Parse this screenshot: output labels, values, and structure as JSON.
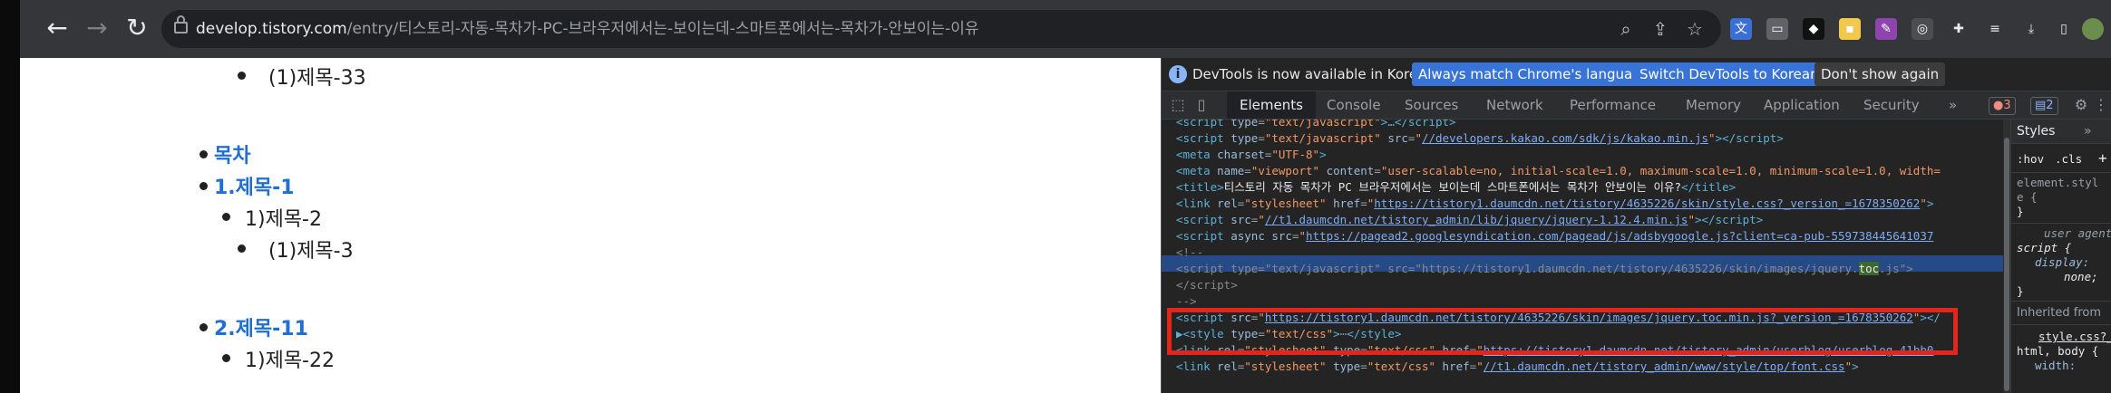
{
  "browser": {
    "url_host": "develop.tistory.com",
    "url_path": "/entry/티스토리-자동-목차가-PC-브라우저에서는-보이는데-스마트폰에서는-목차가-안보이는-이유"
  },
  "page": {
    "items": [
      {
        "text": "(1)제목-33"
      },
      {
        "text": "목차"
      },
      {
        "text": "1.제목-1"
      },
      {
        "text": "1)제목-2"
      },
      {
        "text": "(1)제목-3"
      },
      {
        "text": "2.제목-11"
      },
      {
        "text": "1)제목-22"
      }
    ]
  },
  "devtools": {
    "info_text": "DevTools is now available in Korean!",
    "btn_match": "Always match Chrome's language",
    "btn_switch": "Switch DevTools to Korean",
    "btn_dont_show": "Don't show again",
    "tabs": [
      "Elements",
      "Console",
      "Sources",
      "Network",
      "Performance",
      "Memory",
      "Application",
      "Security",
      "»"
    ],
    "error_count": "3",
    "message_count": "2",
    "styles_tab": "Styles",
    "styles_more": "»",
    "hov": ":hov",
    "cls": ".cls",
    "plus": "+",
    "styles_lines": {
      "element_style_1": "element.styl",
      "element_style_2": "e {",
      "element_style_3": "}",
      "ua": "user agent",
      "script_sel": "script {",
      "display": "display:",
      "none": "none;",
      "close": "}",
      "inherited": "Inherited from",
      "stylecss": "style.css?_",
      "htmlbody": "html, body {",
      "width": "width:"
    }
  }
}
